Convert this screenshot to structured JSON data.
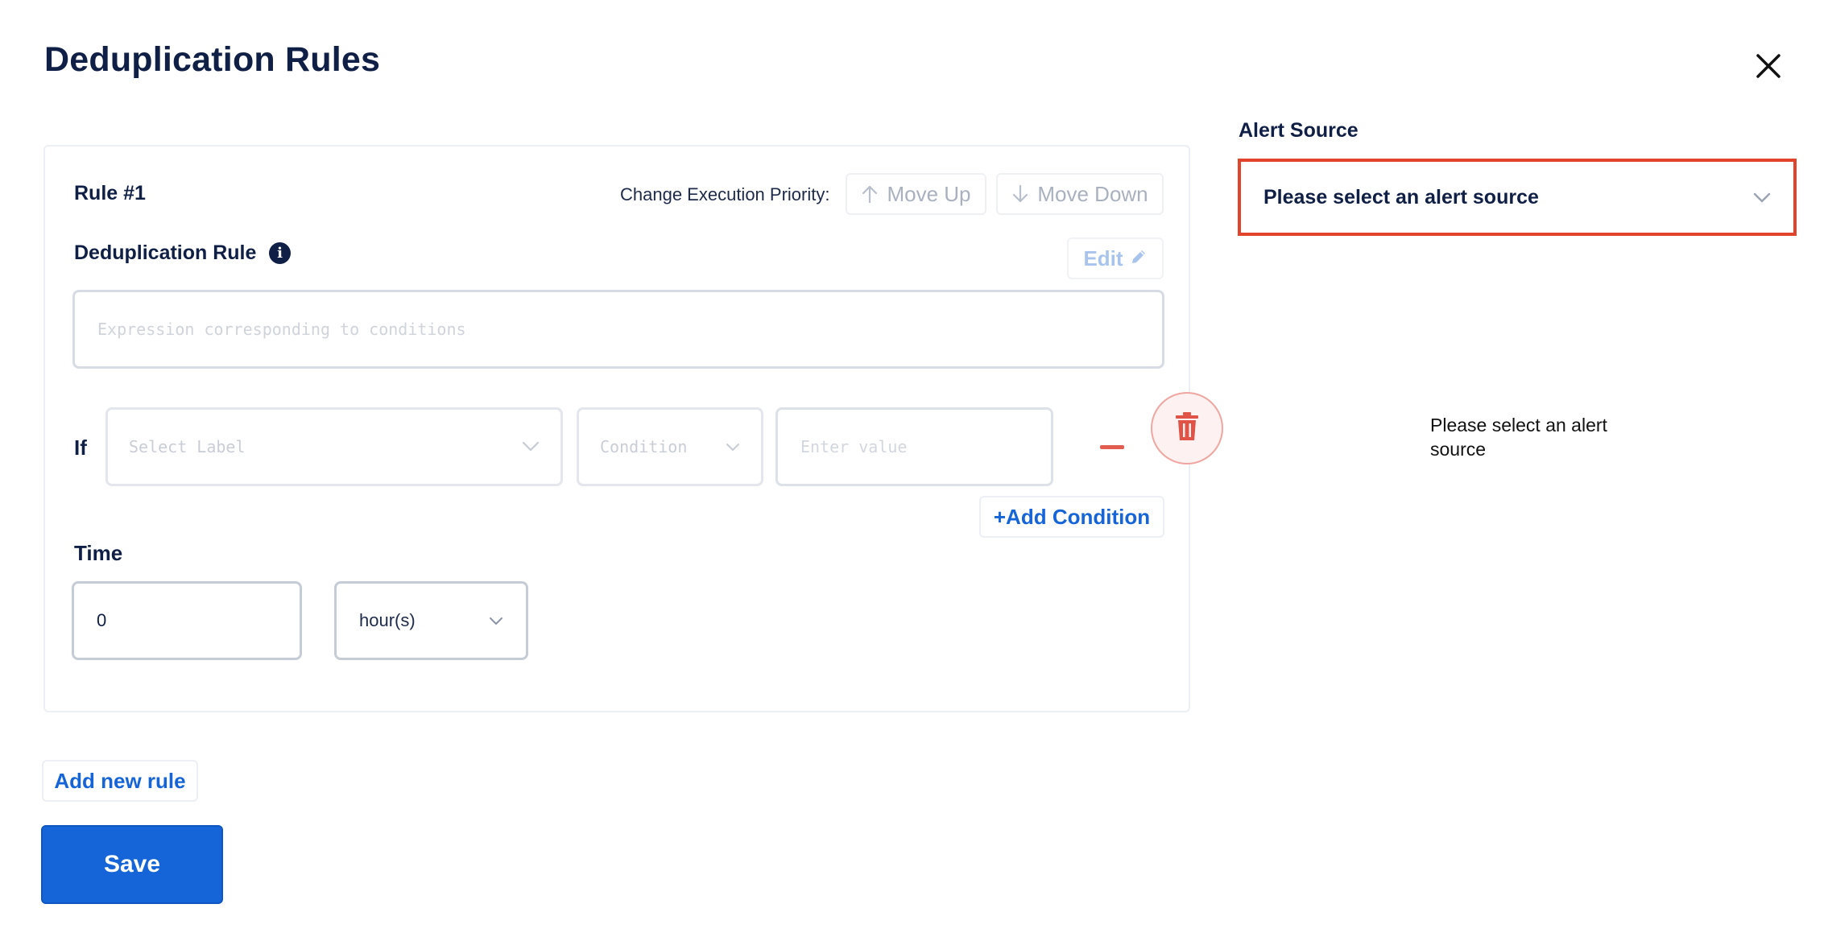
{
  "header": {
    "title": "Deduplication Rules",
    "close_icon": "close-icon"
  },
  "rule": {
    "title": "Rule #1",
    "priority_label": "Change Execution Priority:",
    "move_up_label": "Move Up",
    "move_down_label": "Move Down",
    "dedup_label": "Deduplication Rule",
    "info_icon_glyph": "i",
    "edit_label": "Edit",
    "expression_placeholder": "Expression corresponding to conditions",
    "if_label": "If",
    "label_select_placeholder": "Select Label",
    "condition_select_placeholder": "Condition",
    "value_placeholder": "Enter value",
    "add_condition_label": "+Add Condition",
    "time_label": "Time",
    "time_value": "0",
    "time_unit": "hour(s)"
  },
  "actions": {
    "add_rule_label": "Add new rule",
    "save_label": "Save"
  },
  "alert_source": {
    "label": "Alert Source",
    "select_placeholder": "Please select an alert source",
    "empty_message": "Please select an alert source"
  },
  "colors": {
    "primary": "#1565d8",
    "heading": "#0f1f45",
    "danger": "#e25c50",
    "highlight_border": "#e2442b"
  }
}
